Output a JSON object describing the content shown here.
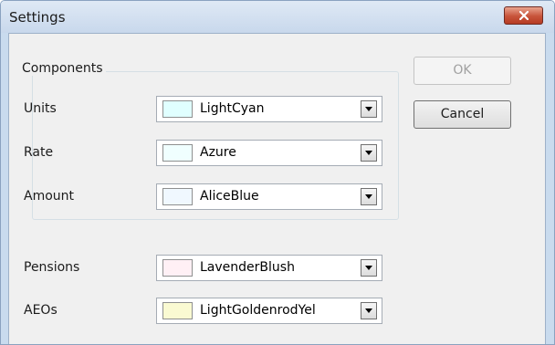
{
  "window": {
    "title": "Settings",
    "close_icon": "close-x-icon"
  },
  "components_group": {
    "legend": "Components",
    "rows": [
      {
        "label": "Units",
        "value": "LightCyan",
        "color": "#e0ffff"
      },
      {
        "label": "Rate",
        "value": "Azure",
        "color": "#f0ffff"
      },
      {
        "label": "Amount",
        "value": "AliceBlue",
        "color": "#f0f8ff"
      }
    ]
  },
  "other_rows": [
    {
      "label": "Pensions",
      "value": "LavenderBlush",
      "color": "#fff0f5"
    },
    {
      "label": "AEOs",
      "value": "LightGoldenrodYel",
      "color": "#fafad2"
    }
  ],
  "buttons": {
    "ok": "OK",
    "ok_enabled": false,
    "cancel": "Cancel"
  },
  "colors": {
    "title_bar": "#c9dbee",
    "close_button": "#c7533a",
    "dialog_body": "#f0f0f0"
  },
  "dropdown_icon": "triangle-down-icon"
}
